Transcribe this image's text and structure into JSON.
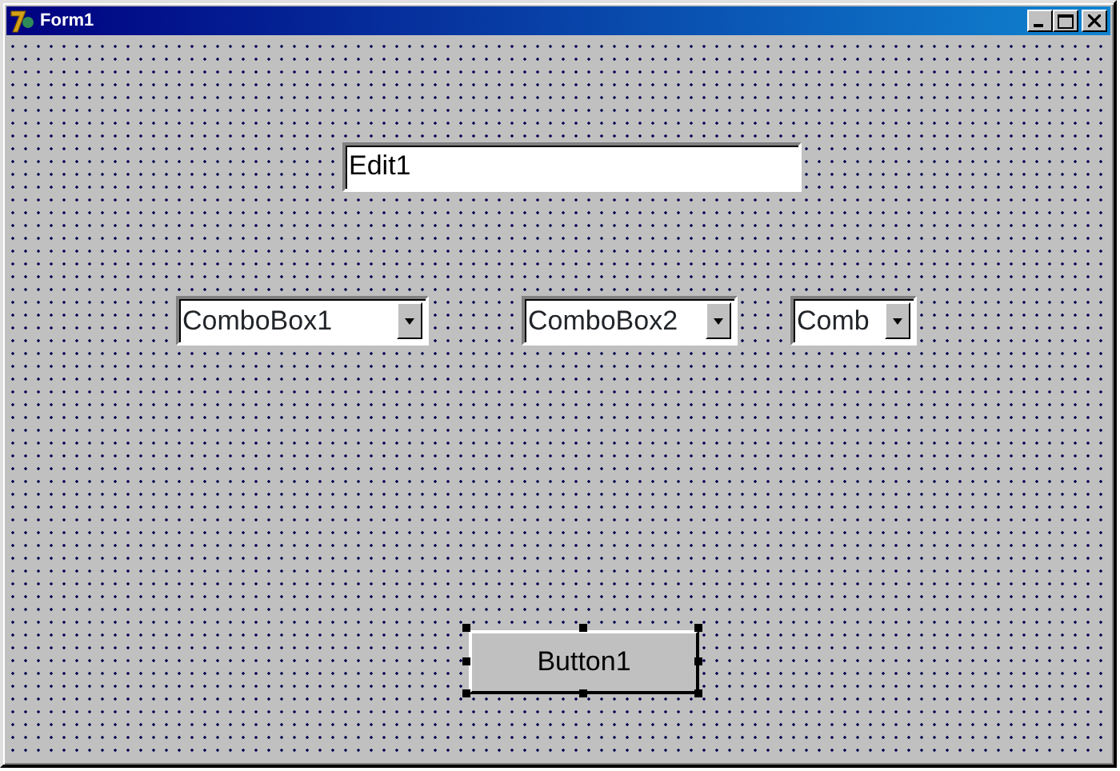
{
  "window": {
    "title": "Form1"
  },
  "edit": {
    "value": "Edit1"
  },
  "combo_boxes": [
    {
      "text": "ComboBox1"
    },
    {
      "text": "ComboBox2"
    },
    {
      "text": "Comb"
    }
  ],
  "button": {
    "label": "Button1",
    "selected": true
  }
}
